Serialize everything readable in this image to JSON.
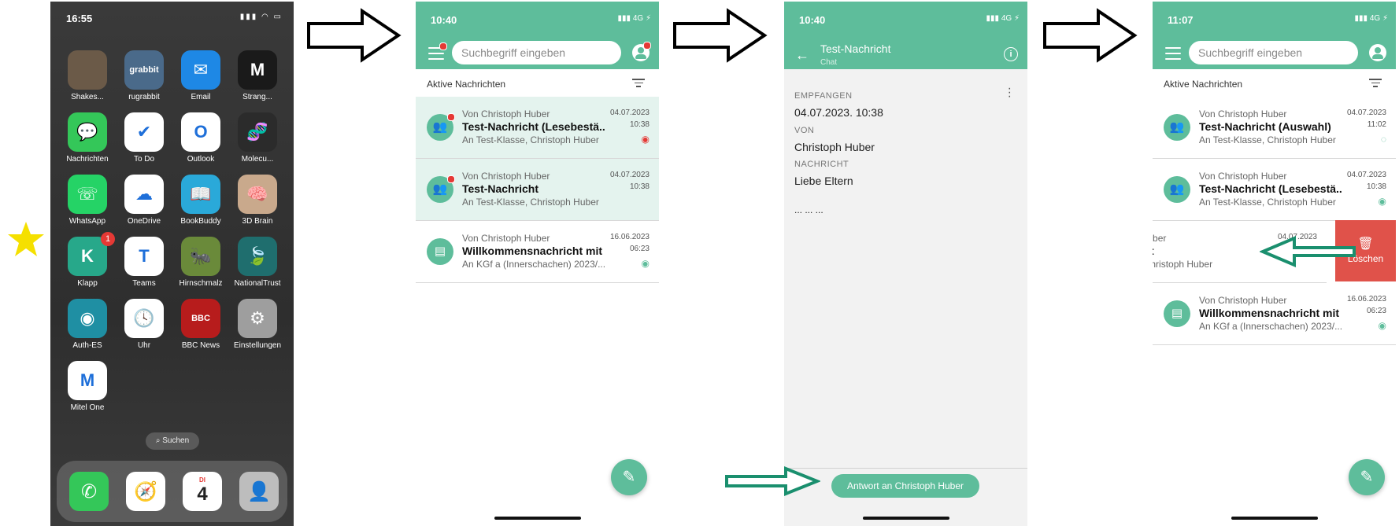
{
  "home": {
    "time": "16:55",
    "apps": [
      {
        "label": "Shakes...",
        "color": "#6b5a48",
        "glyph": ""
      },
      {
        "label": "rugrabbit",
        "color": "#4a6a8a",
        "glyph": "grabbit"
      },
      {
        "label": "Email",
        "color": "#1e88e5",
        "glyph": "✉"
      },
      {
        "label": "Strang...",
        "color": "#1a1a1a",
        "glyph": "M"
      },
      {
        "label": "Nachrichten",
        "color": "#34c759",
        "glyph": "💬"
      },
      {
        "label": "To Do",
        "color": "#ffffff",
        "glyph": "✔"
      },
      {
        "label": "Outlook",
        "color": "#ffffff",
        "glyph": "O"
      },
      {
        "label": "Molecu...",
        "color": "#2b2b2b",
        "glyph": "🧬"
      },
      {
        "label": "WhatsApp",
        "color": "#25d366",
        "glyph": "☏"
      },
      {
        "label": "OneDrive",
        "color": "#ffffff",
        "glyph": "☁"
      },
      {
        "label": "BookBuddy",
        "color": "#2aa9d9",
        "glyph": "📖"
      },
      {
        "label": "3D Brain",
        "color": "#c9a98c",
        "glyph": "🧠"
      },
      {
        "label": "Klapp",
        "color": "#27a88a",
        "glyph": "K",
        "badge": "1"
      },
      {
        "label": "Teams",
        "color": "#ffffff",
        "glyph": "T"
      },
      {
        "label": "Hirnschmalz",
        "color": "#6a8a3a",
        "glyph": "🐜"
      },
      {
        "label": "NationalTrust",
        "color": "#1f6e6e",
        "glyph": "🍃"
      },
      {
        "label": "Auth-ES",
        "color": "#1f8fa3",
        "glyph": "◉"
      },
      {
        "label": "Uhr",
        "color": "#ffffff",
        "glyph": "🕓"
      },
      {
        "label": "BBC News",
        "color": "#b71c1c",
        "glyph": "BBC"
      },
      {
        "label": "Einstellungen",
        "color": "#9e9e9e",
        "glyph": "⚙"
      },
      {
        "label": "Mitel One",
        "color": "#ffffff",
        "glyph": "M"
      }
    ],
    "search_label": "Suchen",
    "dock": [
      {
        "name": "phone",
        "color": "#34c759",
        "glyph": "✆"
      },
      {
        "name": "safari",
        "color": "#ffffff",
        "glyph": "🧭"
      },
      {
        "name": "calendar",
        "color": "#ffffff",
        "glyph": "4",
        "sub": "DI"
      },
      {
        "name": "contacts",
        "color": "#bdbdbd",
        "glyph": "👤"
      }
    ]
  },
  "screen_list": {
    "time": "10:40",
    "signal": "4G",
    "search_placeholder": "Suchbegriff eingeben",
    "section": "Aktive Nachrichten",
    "rows": [
      {
        "from": "Von Christoph Huber",
        "subject": "Test-Nachricht (Lesebestä...",
        "to": "An Test-Klasse, Christoph Huber",
        "date": "04.07.2023",
        "time": "10:38"
      },
      {
        "from": "Von Christoph Huber",
        "subject": "Test-Nachricht",
        "to": "An Test-Klasse, Christoph Huber",
        "date": "04.07.2023",
        "time": "10:38"
      },
      {
        "from": "Von Christoph Huber",
        "subject": "Willkommensnachricht mit ...",
        "to": "An KGf a (Innerschachen) 2023/...",
        "date": "16.06.2023",
        "time": "06:23"
      }
    ]
  },
  "screen_detail": {
    "time": "10:40",
    "signal": "4G",
    "title": "Test-Nachricht",
    "subtitle": "Chat",
    "received_label": "EMPFANGEN",
    "received_value": "04.07.2023. 10:38",
    "from_label": "VON",
    "from_value": "Christoph Huber",
    "message_label": "NACHRICHT",
    "message_value": "Liebe Eltern",
    "ellipsis": "... ... ...",
    "reply_button": "Antwort an Christoph Huber"
  },
  "screen_swipe": {
    "time": "11:07",
    "signal": "4G",
    "search_placeholder": "Suchbegriff eingeben",
    "section": "Aktive Nachrichten",
    "rows": [
      {
        "from": "Von Christoph Huber",
        "subject": "Test-Nachricht (Auswahl)",
        "to": "An Test-Klasse, Christoph Huber",
        "date": "04.07.2023",
        "time": "11:02"
      },
      {
        "from": "Von Christoph Huber",
        "subject": "Test-Nachricht (Lesebestä...",
        "to": "An Test-Klasse, Christoph Huber",
        "date": "04.07.2023",
        "time": "10:38"
      },
      {
        "from": "n Christoph Huber",
        "subject": "st-Nachricht",
        "to": "Test-Klasse, Christoph Huber",
        "date": "04.07.2023",
        "time": ""
      },
      {
        "from": "Von Christoph Huber",
        "subject": "Willkommensnachricht mit ...",
        "to": "An KGf a (Innerschachen) 2023/...",
        "date": "16.06.2023",
        "time": "06:23"
      }
    ],
    "delete_label": "Löschen"
  },
  "colors": {
    "accent": "#5ebd9b",
    "unread_bg": "#e4f3ee",
    "delete": "#e0524a",
    "annotation_arrow": "#1a8f6e",
    "star": "#f5e000"
  }
}
